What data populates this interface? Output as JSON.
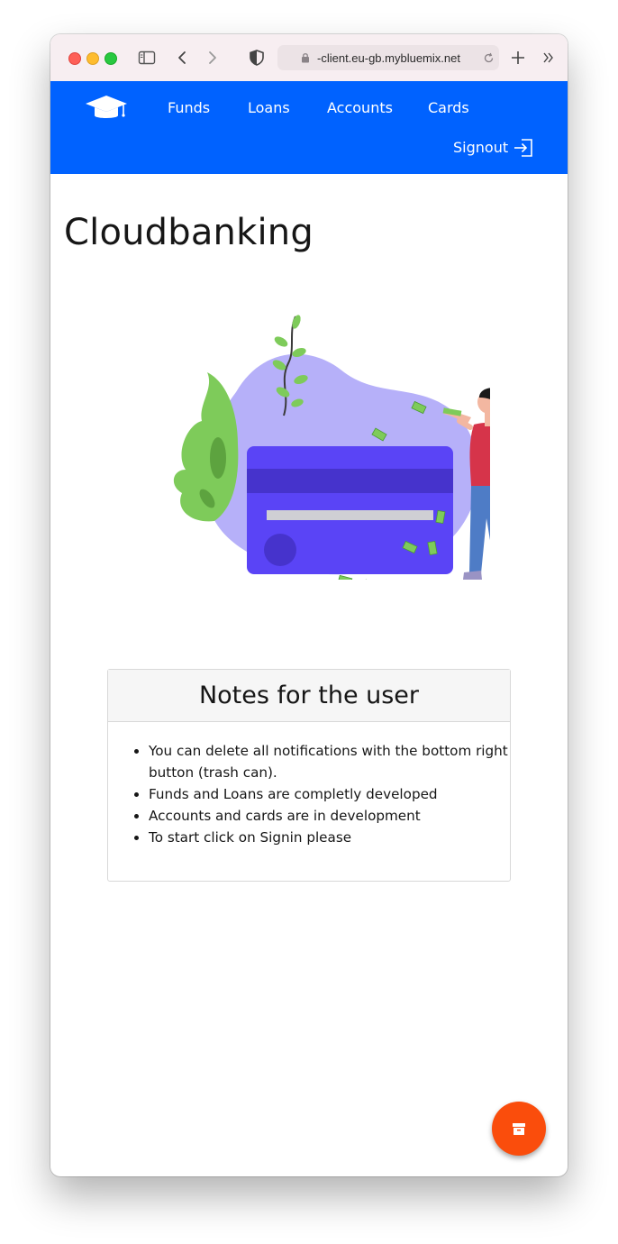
{
  "browser": {
    "url": "-client.eu-gb.mybluemix.net"
  },
  "nav": {
    "links": [
      {
        "label": "Funds"
      },
      {
        "label": "Loans"
      },
      {
        "label": "Accounts"
      },
      {
        "label": "Cards"
      }
    ],
    "signout_label": "Signout",
    "brand_color": "#0062ff"
  },
  "main": {
    "title": "Cloudbanking"
  },
  "notes": {
    "title": "Notes for the user",
    "items": [
      "You can delete all notifications with the bottom right button (trash can).",
      "Funds and Loans are completly developed",
      "Accounts and cards are in development",
      "To start click on Signin please"
    ]
  },
  "fab": {
    "icon": "archive-icon",
    "color": "#fa4d0c"
  }
}
